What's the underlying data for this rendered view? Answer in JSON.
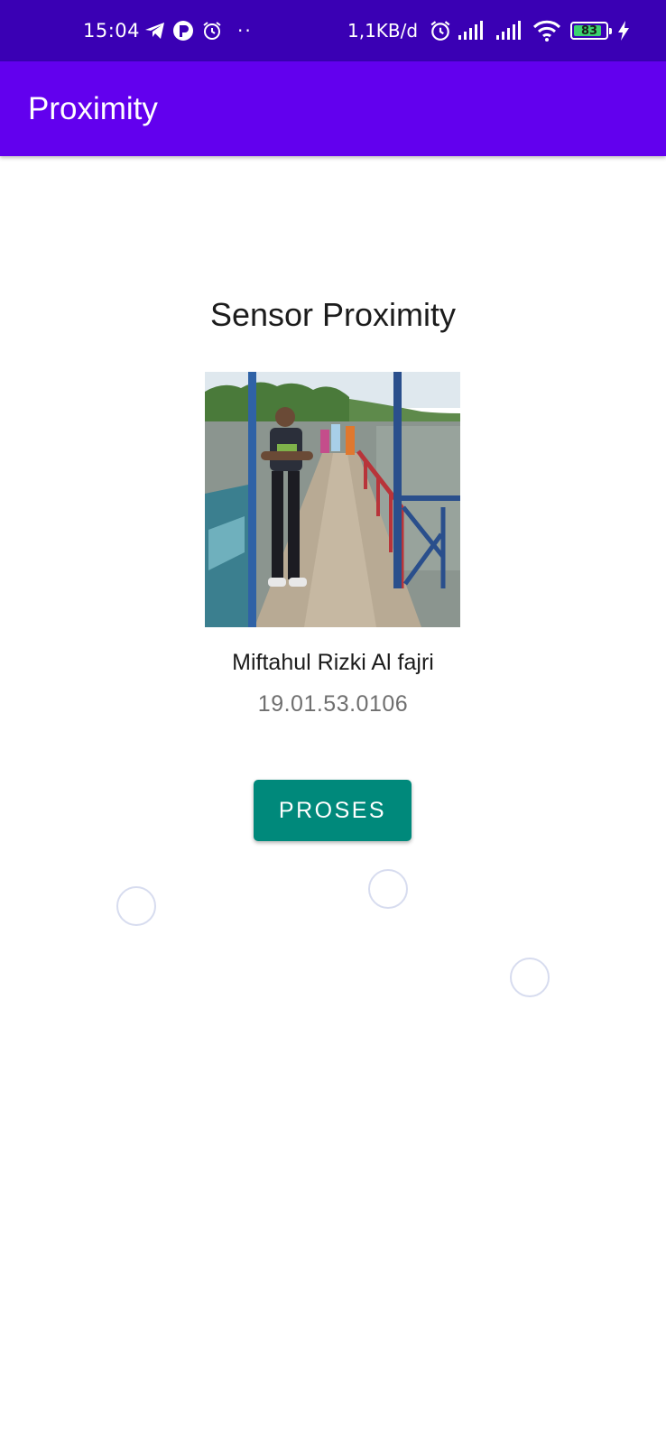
{
  "status_bar": {
    "time": "15:04",
    "dots": "··",
    "network_speed": "1,1KB/d",
    "battery_level": "83",
    "icons": [
      "telegram-icon",
      "app-icon",
      "alarm-icon",
      "alarm-icon",
      "signal-icon",
      "signal-icon",
      "wifi-icon",
      "battery-icon",
      "charging-icon"
    ]
  },
  "app_bar": {
    "title": "Proximity",
    "color": "#6200ee"
  },
  "content": {
    "heading": "Sensor Proximity",
    "name": "Miftahul Rizki Al fajri",
    "student_id": "19.01.53.0106",
    "button_label": "PROSES"
  },
  "colors": {
    "status_bar": "#3a00b4",
    "app_bar": "#6200ee",
    "button": "#00897b"
  }
}
